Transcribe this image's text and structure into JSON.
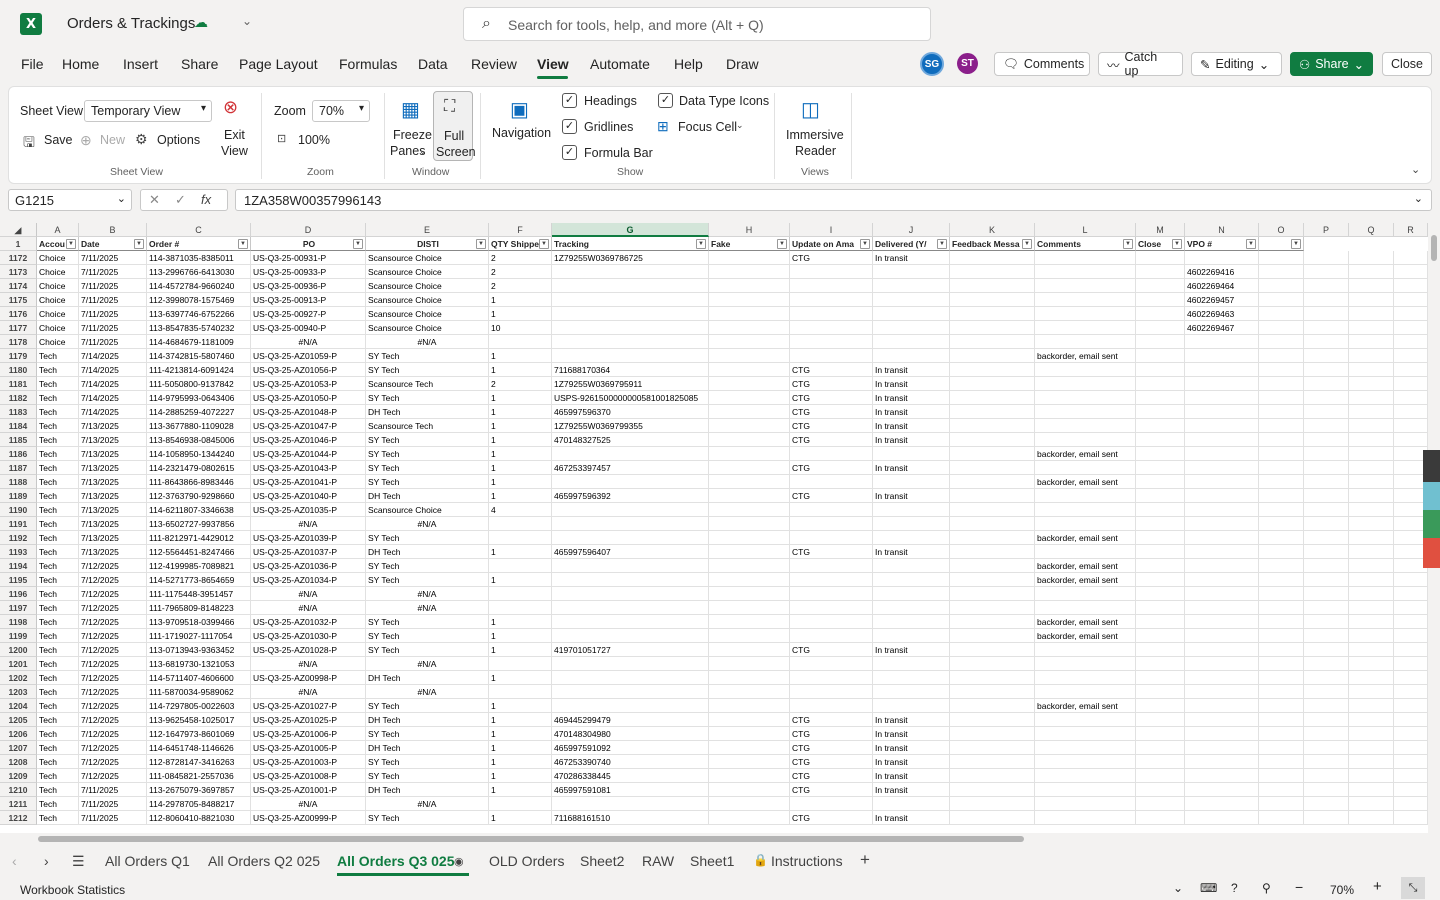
{
  "app": {
    "logo": "X",
    "title": "Orders & Trackings",
    "search_placeholder": "Search for tools, help, and more (Alt + Q)"
  },
  "ribbon_tabs": [
    "File",
    "Home",
    "Insert",
    "Share",
    "Page Layout",
    "Formulas",
    "Data",
    "Review",
    "View",
    "Automate",
    "Help",
    "Draw"
  ],
  "active_tab": "View",
  "avatars": [
    {
      "initials": "SG",
      "color": "#0f6cbd"
    },
    {
      "initials": "ST",
      "color": "#8b1f8b"
    }
  ],
  "top_buttons": {
    "comments": "Comments",
    "catchup": "Catch up",
    "editing": "Editing",
    "share": "Share",
    "close": "Close"
  },
  "ribbon": {
    "sheet_view_label": "Sheet View",
    "sheet_view_value": "Temporary View",
    "save": "Save",
    "new": "New",
    "options": "Options",
    "exit_view_1": "Exit",
    "exit_view_2": "View",
    "group_sheet_view": "Sheet View",
    "zoom_label": "Zoom",
    "zoom_value": "70%",
    "zoom_100": "100%",
    "group_zoom": "Zoom",
    "freeze_1": "Freeze",
    "freeze_2": "Panes",
    "full_1": "Full",
    "full_2": "Screen",
    "group_window": "Window",
    "navigation": "Navigation",
    "headings": "Headings",
    "gridlines": "Gridlines",
    "formula_bar": "Formula Bar",
    "data_type_icons": "Data Type Icons",
    "focus_cell": "Focus Cell",
    "group_show": "Show",
    "immersive_1": "Immersive",
    "immersive_2": "Reader",
    "group_views": "Views"
  },
  "formula": {
    "name_box": "G1215",
    "fx": "fx",
    "value": "1ZA358W00357996143"
  },
  "columns": [
    "A",
    "B",
    "C",
    "D",
    "E",
    "F",
    "G",
    "H",
    "I",
    "J",
    "K",
    "L",
    "M",
    "N",
    "O",
    "P",
    "Q",
    "R"
  ],
  "headers": [
    "Accou",
    "Date",
    "Order #",
    "PO",
    "DISTI",
    "QTY Shippe",
    "Tracking",
    "Fake",
    "Update on Ama",
    "Delivered (Y/",
    "Feedback Messa",
    "Comments",
    "Close",
    "VPO #",
    ""
  ],
  "rows": [
    [
      "1172",
      "Choice",
      "7/11/2025",
      "114-3871035-8385011",
      "US-Q3-25-00931-P",
      "Scansource Choice",
      "2",
      "1Z79255W0369786725",
      "",
      "CTG",
      "In transit",
      "",
      "",
      "",
      ""
    ],
    [
      "1173",
      "Choice",
      "7/11/2025",
      "113-2996766-6413030",
      "US-Q3-25-00933-P",
      "Scansource Choice",
      "2",
      "",
      "",
      "",
      "",
      "",
      "",
      "",
      "4602269416"
    ],
    [
      "1174",
      "Choice",
      "7/11/2025",
      "114-4572784-9660240",
      "US-Q3-25-00936-P",
      "Scansource Choice",
      "2",
      "",
      "",
      "",
      "",
      "",
      "",
      "",
      "4602269464"
    ],
    [
      "1175",
      "Choice",
      "7/11/2025",
      "112-3998078-1575469",
      "US-Q3-25-00913-P",
      "Scansource Choice",
      "1",
      "",
      "",
      "",
      "",
      "",
      "",
      "",
      "4602269457"
    ],
    [
      "1176",
      "Choice",
      "7/11/2025",
      "113-6397746-6752266",
      "US-Q3-25-00927-P",
      "Scansource Choice",
      "1",
      "",
      "",
      "",
      "",
      "",
      "",
      "",
      "4602269463"
    ],
    [
      "1177",
      "Choice",
      "7/11/2025",
      "113-8547835-5740232",
      "US-Q3-25-00940-P",
      "Scansource Choice",
      "10",
      "",
      "",
      "",
      "",
      "",
      "",
      "",
      "4602269467"
    ],
    [
      "1178",
      "Choice",
      "7/11/2025",
      "114-4684679-1181009",
      "#N/A",
      "#N/A",
      "",
      "",
      "",
      "",
      "",
      "",
      "",
      "",
      ""
    ],
    [
      "1179",
      "Tech",
      "7/14/2025",
      "114-3742815-5807460",
      "US-Q3-25-AZ01059-P",
      "SY Tech",
      "1",
      "",
      "",
      "",
      "",
      "",
      "backorder, email sent",
      "",
      ""
    ],
    [
      "1180",
      "Tech",
      "7/14/2025",
      "111-4213814-6091424",
      "US-Q3-25-AZ01056-P",
      "SY Tech",
      "1",
      "711688170364",
      "",
      "CTG",
      "In transit",
      "",
      "",
      "",
      ""
    ],
    [
      "1181",
      "Tech",
      "7/14/2025",
      "111-5050800-9137842",
      "US-Q3-25-AZ01053-P",
      "Scansource Tech",
      "2",
      "1Z79255W0369795911",
      "",
      "CTG",
      "In transit",
      "",
      "",
      "",
      ""
    ],
    [
      "1182",
      "Tech",
      "7/14/2025",
      "114-9795993-0643406",
      "US-Q3-25-AZ01050-P",
      "SY Tech",
      "1",
      "USPS-9261500000000581001825085",
      "",
      "CTG",
      "In transit",
      "",
      "",
      "",
      ""
    ],
    [
      "1183",
      "Tech",
      "7/14/2025",
      "114-2885259-4072227",
      "US-Q3-25-AZ01048-P",
      "DH Tech",
      "1",
      "465997596370",
      "",
      "CTG",
      "In transit",
      "",
      "",
      "",
      ""
    ],
    [
      "1184",
      "Tech",
      "7/13/2025",
      "113-3677880-1109028",
      "US-Q3-25-AZ01047-P",
      "Scansource Tech",
      "1",
      "1Z79255W0369799355",
      "",
      "CTG",
      "In transit",
      "",
      "",
      "",
      ""
    ],
    [
      "1185",
      "Tech",
      "7/13/2025",
      "113-8546938-0845006",
      "US-Q3-25-AZ01046-P",
      "SY Tech",
      "1",
      "470148327525",
      "",
      "CTG",
      "In transit",
      "",
      "",
      "",
      ""
    ],
    [
      "1186",
      "Tech",
      "7/13/2025",
      "114-1058950-1344240",
      "US-Q3-25-AZ01044-P",
      "SY Tech",
      "1",
      "",
      "",
      "",
      "",
      "",
      "backorder, email sent",
      "",
      ""
    ],
    [
      "1187",
      "Tech",
      "7/13/2025",
      "114-2321479-0802615",
      "US-Q3-25-AZ01043-P",
      "SY Tech",
      "1",
      "467253397457",
      "",
      "CTG",
      "In transit",
      "",
      "",
      "",
      ""
    ],
    [
      "1188",
      "Tech",
      "7/13/2025",
      "111-8643866-8983446",
      "US-Q3-25-AZ01041-P",
      "SY Tech",
      "1",
      "",
      "",
      "",
      "",
      "",
      "backorder, email sent",
      "",
      ""
    ],
    [
      "1189",
      "Tech",
      "7/13/2025",
      "112-3763790-9298660",
      "US-Q3-25-AZ01040-P",
      "DH Tech",
      "1",
      "465997596392",
      "",
      "CTG",
      "In transit",
      "",
      "",
      "",
      ""
    ],
    [
      "1190",
      "Tech",
      "7/13/2025",
      "114-6211807-3346638",
      "US-Q3-25-AZ01035-P",
      "Scansource Choice",
      "4",
      "",
      "",
      "",
      "",
      "",
      "",
      "",
      ""
    ],
    [
      "1191",
      "Tech",
      "7/13/2025",
      "113-6502727-9937856",
      "#N/A",
      "#N/A",
      "",
      "",
      "",
      "",
      "",
      "",
      "",
      "",
      ""
    ],
    [
      "1192",
      "Tech",
      "7/13/2025",
      "111-8212971-4429012",
      "US-Q3-25-AZ01039-P",
      "SY Tech",
      "",
      "",
      "",
      "",
      "",
      "",
      "backorder, email sent",
      "",
      ""
    ],
    [
      "1193",
      "Tech",
      "7/13/2025",
      "112-5564451-8247466",
      "US-Q3-25-AZ01037-P",
      "DH Tech",
      "1",
      "465997596407",
      "",
      "CTG",
      "In transit",
      "",
      "",
      "",
      ""
    ],
    [
      "1194",
      "Tech",
      "7/12/2025",
      "112-4199985-7089821",
      "US-Q3-25-AZ01036-P",
      "SY Tech",
      "",
      "",
      "",
      "",
      "",
      "",
      "backorder, email sent",
      "",
      ""
    ],
    [
      "1195",
      "Tech",
      "7/12/2025",
      "114-5271773-8654659",
      "US-Q3-25-AZ01034-P",
      "SY Tech",
      "1",
      "",
      "",
      "",
      "",
      "",
      "backorder, email sent",
      "",
      ""
    ],
    [
      "1196",
      "Tech",
      "7/12/2025",
      "111-1175448-3951457",
      "#N/A",
      "#N/A",
      "",
      "",
      "",
      "",
      "",
      "",
      "",
      "",
      ""
    ],
    [
      "1197",
      "Tech",
      "7/12/2025",
      "111-7965809-8148223",
      "#N/A",
      "#N/A",
      "",
      "",
      "",
      "",
      "",
      "",
      "",
      "",
      ""
    ],
    [
      "1198",
      "Tech",
      "7/12/2025",
      "113-9709518-0399466",
      "US-Q3-25-AZ01032-P",
      "SY Tech",
      "1",
      "",
      "",
      "",
      "",
      "",
      "backorder, email sent",
      "",
      ""
    ],
    [
      "1199",
      "Tech",
      "7/12/2025",
      "111-1719027-1117054",
      "US-Q3-25-AZ01030-P",
      "SY Tech",
      "1",
      "",
      "",
      "",
      "",
      "",
      "backorder, email sent",
      "",
      ""
    ],
    [
      "1200",
      "Tech",
      "7/12/2025",
      "113-0713943-9363452",
      "US-Q3-25-AZ01028-P",
      "SY Tech",
      "1",
      "419701051727",
      "",
      "CTG",
      "In transit",
      "",
      "",
      "",
      ""
    ],
    [
      "1201",
      "Tech",
      "7/12/2025",
      "113-6819730-1321053",
      "#N/A",
      "#N/A",
      "",
      "",
      "",
      "",
      "",
      "",
      "",
      "",
      ""
    ],
    [
      "1202",
      "Tech",
      "7/12/2025",
      "114-5711407-4606600",
      "US-Q3-25-AZ00998-P",
      "DH Tech",
      "1",
      "",
      "",
      "",
      "",
      "",
      "",
      "",
      ""
    ],
    [
      "1203",
      "Tech",
      "7/12/2025",
      "111-5870034-9589062",
      "#N/A",
      "#N/A",
      "",
      "",
      "",
      "",
      "",
      "",
      "",
      "",
      ""
    ],
    [
      "1204",
      "Tech",
      "7/12/2025",
      "114-7297805-0022603",
      "US-Q3-25-AZ01027-P",
      "SY Tech",
      "1",
      "",
      "",
      "",
      "",
      "",
      "backorder, email sent",
      "",
      ""
    ],
    [
      "1205",
      "Tech",
      "7/12/2025",
      "113-9625458-1025017",
      "US-Q3-25-AZ01025-P",
      "DH Tech",
      "1",
      "469445299479",
      "",
      "CTG",
      "In transit",
      "",
      "",
      "",
      ""
    ],
    [
      "1206",
      "Tech",
      "7/12/2025",
      "112-1647973-8601069",
      "US-Q3-25-AZ01006-P",
      "SY Tech",
      "1",
      "470148304980",
      "",
      "CTG",
      "In transit",
      "",
      "",
      "",
      ""
    ],
    [
      "1207",
      "Tech",
      "7/12/2025",
      "114-6451748-1146626",
      "US-Q3-25-AZ01005-P",
      "DH Tech",
      "1",
      "465997591092",
      "",
      "CTG",
      "In transit",
      "",
      "",
      "",
      ""
    ],
    [
      "1208",
      "Tech",
      "7/12/2025",
      "112-8728147-3416263",
      "US-Q3-25-AZ01003-P",
      "SY Tech",
      "1",
      "467253390740",
      "",
      "CTG",
      "In transit",
      "",
      "",
      "",
      ""
    ],
    [
      "1209",
      "Tech",
      "7/12/2025",
      "111-0845821-2557036",
      "US-Q3-25-AZ01008-P",
      "SY Tech",
      "1",
      "470286338445",
      "",
      "CTG",
      "In transit",
      "",
      "",
      "",
      ""
    ],
    [
      "1210",
      "Tech",
      "7/11/2025",
      "113-2675079-3697857",
      "US-Q3-25-AZ01001-P",
      "DH Tech",
      "1",
      "465997591081",
      "",
      "CTG",
      "In transit",
      "",
      "",
      "",
      ""
    ],
    [
      "1211",
      "Tech",
      "7/11/2025",
      "114-2978705-8488217",
      "#N/A",
      "#N/A",
      "",
      "",
      "",
      "",
      "",
      "",
      "",
      "",
      ""
    ],
    [
      "1212",
      "Tech",
      "7/11/2025",
      "112-8060410-8821030",
      "US-Q3-25-AZ00999-P",
      "SY Tech",
      "1",
      "711688161510",
      "",
      "CTG",
      "In transit",
      "",
      "",
      "",
      ""
    ]
  ],
  "sheet_tabs": [
    "All Orders Q1",
    "All Orders Q2 025",
    "All Orders Q3 025",
    "OLD Orders",
    "Sheet2",
    "RAW",
    "Sheet1",
    "Instructions"
  ],
  "active_sheet": "All Orders Q3 025",
  "status": {
    "left": "Workbook Statistics",
    "zoom": "70%"
  }
}
